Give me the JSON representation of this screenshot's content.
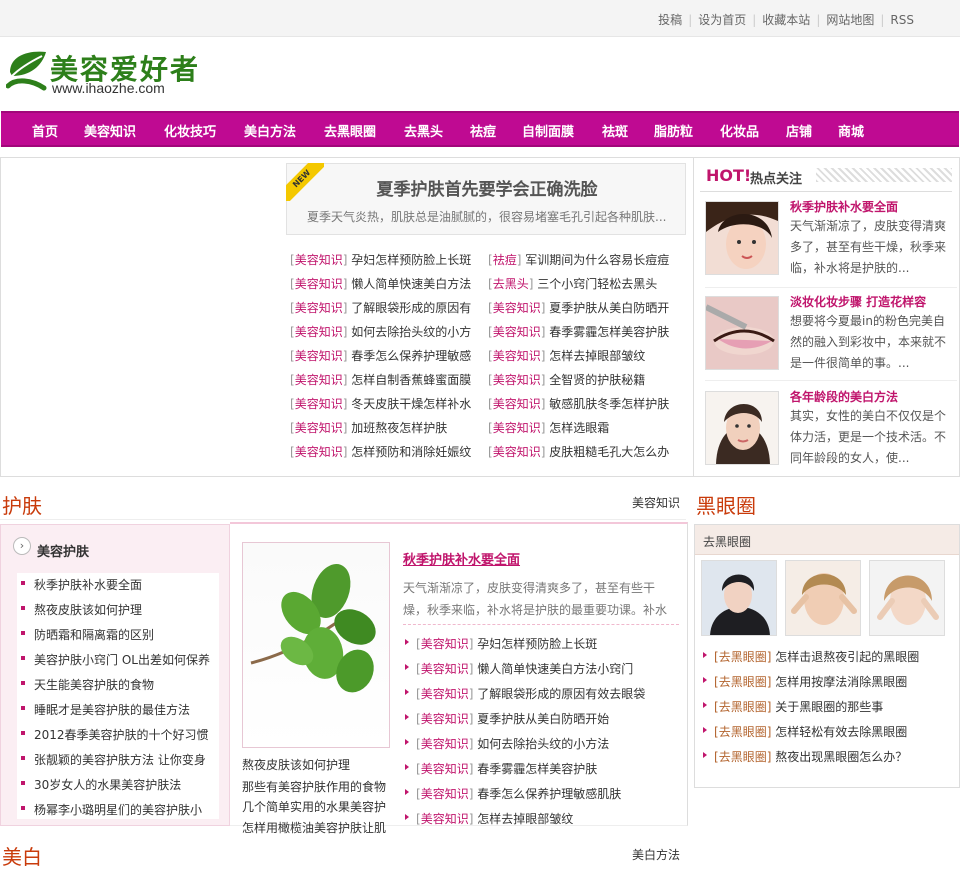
{
  "topbar": {
    "links": [
      "投稿",
      "设为首页",
      "收藏本站",
      "网站地图",
      "RSS"
    ]
  },
  "logo": {
    "title": "美容爱好者",
    "url": "www.ihaozhe.com"
  },
  "nav": [
    "首页",
    "美容知识",
    "化妆技巧",
    "美白方法",
    "去黑眼圈",
    "去黑头",
    "祛痘",
    "自制面膜",
    "祛斑",
    "脂肪粒",
    "化妆品",
    "店铺",
    "商城"
  ],
  "feature": {
    "new_badge": "NEW",
    "title": "夏季护肤首先要学会正确洗脸",
    "desc": "夏季天气炎热，肌肤总是油腻腻的，很容易堵塞毛孔引起各种肌肤..."
  },
  "news_left": [
    {
      "tag": "美容知识",
      "text": "孕妇怎样预防脸上长斑"
    },
    {
      "tag": "美容知识",
      "text": "懒人简单快速美白方法"
    },
    {
      "tag": "美容知识",
      "text": "了解眼袋形成的原因有"
    },
    {
      "tag": "美容知识",
      "text": "如何去除抬头纹的小方"
    },
    {
      "tag": "美容知识",
      "text": "春季怎么保养护理敏感"
    },
    {
      "tag": "美容知识",
      "text": "怎样自制香蕉蜂蜜面膜"
    },
    {
      "tag": "美容知识",
      "text": "冬天皮肤干燥怎样补水"
    },
    {
      "tag": "美容知识",
      "text": "加班熬夜怎样护肤"
    },
    {
      "tag": "美容知识",
      "text": "怎样预防和消除妊娠纹"
    }
  ],
  "news_right": [
    {
      "tag": "祛痘",
      "text": "军训期间为什么容易长痘痘"
    },
    {
      "tag": "去黑头",
      "text": "三个小窍门轻松去黑头"
    },
    {
      "tag": "美容知识",
      "text": "夏季护肤从美白防晒开"
    },
    {
      "tag": "美容知识",
      "text": "春季雾霾怎样美容护肤"
    },
    {
      "tag": "美容知识",
      "text": "怎样去掉眼部皱纹"
    },
    {
      "tag": "美容知识",
      "text": "全智贤的护肤秘籍"
    },
    {
      "tag": "美容知识",
      "text": "敏感肌肤冬季怎样护肤"
    },
    {
      "tag": "美容知识",
      "text": "怎样选眼霜"
    },
    {
      "tag": "美容知识",
      "text": "皮肤粗糙毛孔大怎么办"
    }
  ],
  "hot": {
    "label": "HOT!",
    "title": "热点关注",
    "items": [
      {
        "title": "秋季护肤补水要全面",
        "desc": "天气渐渐凉了，皮肤变得清爽多了，甚至有些干燥，秋季来临，补水将是护肤的..."
      },
      {
        "title": "淡妆化妆步骤 打造花样容",
        "desc": "想要将今夏最in的粉色完美自然的融入到彩妆中，本来就不是一件很简单的事。..."
      },
      {
        "title": "各年龄段的美白方法",
        "desc": "其实，女性的美白不仅仅是个体力活，更是一个技术活。不同年龄段的女人，使..."
      }
    ]
  },
  "skincare": {
    "section_title": "护肤",
    "more": "美容知识",
    "list_title": "美容护肤",
    "list": [
      "秋季护肤补水要全面",
      "熬夜皮肤该如何护理",
      "防晒霜和隔离霜的区别",
      "美容护肤小窍门 OL出差如何保养",
      "天生能美容护肤的食物",
      "睡眠才是美容护肤的最佳方法",
      "2012春季美容护肤的十个好习惯",
      "张靓颖的美容护肤方法 让你变身",
      "30岁女人的水果美容护肤法",
      "杨幂李小璐明星们的美容护肤小"
    ],
    "image_captions": [
      "熬夜皮肤该如何护理",
      "那些有美容护肤作用的食物",
      "几个简单实用的水果美容护",
      "怎样用橄榄油美容护肤让肌"
    ],
    "feature_title": "秋季护肤补水要全面",
    "feature_desc": "天气渐渐凉了，皮肤变得清爽多了，甚至有些干燥，秋季来临，补水将是护肤的最重要功课。补水",
    "links": [
      {
        "tag": "美容知识",
        "text": "孕妇怎样预防脸上长斑"
      },
      {
        "tag": "美容知识",
        "text": "懒人简单快速美白方法小窍门"
      },
      {
        "tag": "美容知识",
        "text": "了解眼袋形成的原因有效去眼袋"
      },
      {
        "tag": "美容知识",
        "text": "夏季护肤从美白防晒开始"
      },
      {
        "tag": "美容知识",
        "text": "如何去除抬头纹的小方法"
      },
      {
        "tag": "美容知识",
        "text": "春季雾霾怎样美容护肤"
      },
      {
        "tag": "美容知识",
        "text": "春季怎么保养护理敏感肌肤"
      },
      {
        "tag": "美容知识",
        "text": "怎样去掉眼部皱纹"
      }
    ]
  },
  "dark_circles": {
    "section_title": "黑眼圈",
    "box_title": "去黑眼圈",
    "links": [
      {
        "tag": "去黑眼圈",
        "text": "怎样击退熬夜引起的黑眼圈"
      },
      {
        "tag": "去黑眼圈",
        "text": "怎样用按摩法消除黑眼圈"
      },
      {
        "tag": "去黑眼圈",
        "text": "关于黑眼圈的那些事"
      },
      {
        "tag": "去黑眼圈",
        "text": "怎样轻松有效去除黑眼圈"
      },
      {
        "tag": "去黑眼圈",
        "text": "熬夜出现黑眼圈怎么办？"
      }
    ]
  },
  "whitening": {
    "section_title": "美白",
    "more": "美白方法"
  },
  "colors": {
    "brand": "#bf0a92",
    "accent": "#c0156c",
    "section": "#c93b0b"
  }
}
